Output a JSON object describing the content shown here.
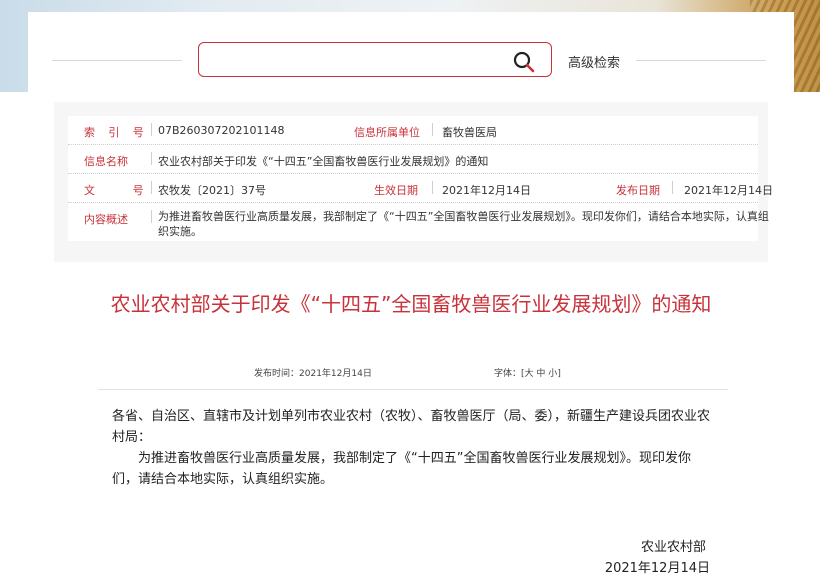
{
  "search": {
    "placeholder": "",
    "advanced_label": "高级检索"
  },
  "meta": {
    "index_label": "索 引 号",
    "index_value": "07B260307202101148",
    "unit_label": "信息所属单位",
    "unit_value": "畜牧兽医局",
    "name_label": "信息名称",
    "name_value": "农业农村部关于印发《“十四五”全国畜牧兽医行业发展规划》的通知",
    "doc_no_label": "文 号",
    "doc_no_value": "农牧发〔2021〕37号",
    "effective_label": "生效日期",
    "effective_value": "2021年12月14日",
    "publish_label": "发布日期",
    "publish_value": "2021年12月14日",
    "summary_label": "内容概述",
    "summary_value": "为推进畜牧兽医行业高质量发展，我部制定了《“十四五”全国畜牧兽医行业发展规划》。现印发你们，请结合本地实际，认真组织实施。"
  },
  "doc": {
    "title": "农业农村部关于印发《“十四五”全国畜牧兽医行业发展规划》的通知",
    "publish_time_label": "发布时间：",
    "publish_time": "2021年12月14日",
    "font_label": "字体：[",
    "font_large": "大",
    "font_medium": "中",
    "font_small": "小",
    "font_close": "]",
    "para1": "各省、自治区、直辖市及计划单列市农业农村（农牧）、畜牧兽医厅（局、委），新疆生产建设兵团农业农村局：",
    "para2": "为推进畜牧兽医行业高质量发展，我部制定了《“十四五”全国畜牧兽医行业发展规划》。现印发你们，请结合本地实际，认真组织实施。",
    "sign_org": "农业农村部",
    "sign_date": "2021年12月14日"
  },
  "colors": {
    "accent": "#c8323a",
    "text": "#333333",
    "panel_bg": "#f6f6f6"
  }
}
